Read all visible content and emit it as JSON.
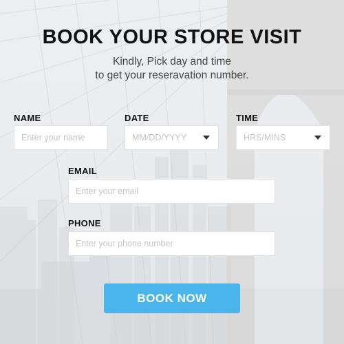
{
  "header": {
    "title": "BOOK YOUR STORE VISIT",
    "subtitle_line1": "Kindly, Pick day and time",
    "subtitle_line2": "to get your reseravation number."
  },
  "form": {
    "name": {
      "label": "NAME",
      "placeholder": "Enter your name"
    },
    "date": {
      "label": "DATE",
      "placeholder": "MM/DD/YYYY"
    },
    "time": {
      "label": "TIME",
      "placeholder": "HRS/MINS"
    },
    "email": {
      "label": "EMAIL",
      "placeholder": "Enter your email"
    },
    "phone": {
      "label": "PHONE",
      "placeholder": "Enter your phone number"
    },
    "submit_label": "BOOK NOW"
  },
  "colors": {
    "accent": "#49b5ea",
    "text": "#111111",
    "placeholder": "#c3c6c9"
  },
  "icons": {
    "date_dropdown": "caret-down-icon",
    "time_dropdown": "caret-down-icon"
  }
}
